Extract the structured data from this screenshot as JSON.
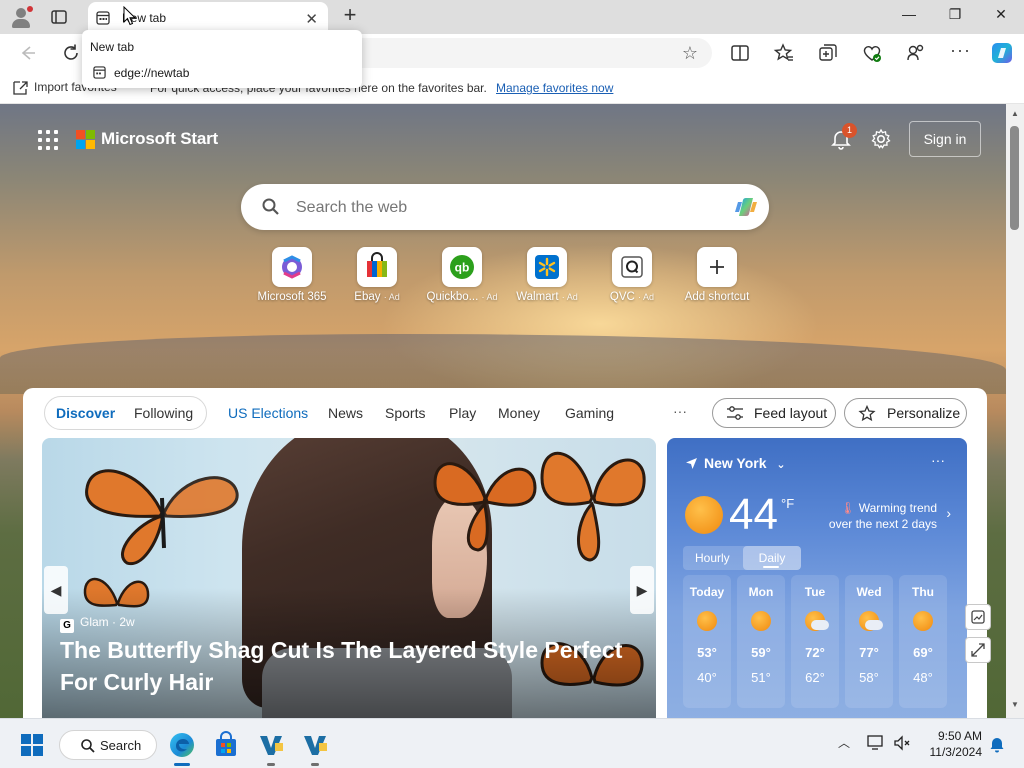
{
  "browser": {
    "tab_title": "New tab",
    "tooltip_title": "New tab",
    "tooltip_url": "edge://newtab",
    "favorites_import": "Import favorites",
    "favorites_hint": "For quick access, place your favorites here on the favorites bar.",
    "favorites_manage": "Manage favorites now",
    "window_controls": {
      "minimize": "—",
      "maximize": "❐",
      "close": "✕"
    }
  },
  "start": {
    "brand": "Microsoft Start",
    "notification_count": "1",
    "sign_in": "Sign in",
    "search_placeholder": "Search the web",
    "shortcuts": [
      {
        "name": "Microsoft 365",
        "ad": ""
      },
      {
        "name": "Ebay",
        "ad": "· Ad"
      },
      {
        "name": "Quickbo...",
        "ad": "· Ad"
      },
      {
        "name": "Walmart",
        "ad": "· Ad"
      },
      {
        "name": "QVC",
        "ad": "· Ad"
      },
      {
        "name": "Add shortcut",
        "ad": ""
      }
    ]
  },
  "feed": {
    "tabs": {
      "discover": "Discover",
      "following": "Following"
    },
    "nav": [
      "US Elections",
      "News",
      "Sports",
      "Play",
      "Money",
      "Gaming"
    ],
    "more": "···",
    "feed_layout": "Feed layout",
    "personalize": "Personalize",
    "hero": {
      "source": "Glam",
      "source_icon": "G",
      "age": "· 2w",
      "headline": "The Butterfly Shag Cut Is The Layered Style Perfect For Curly Hair"
    }
  },
  "weather": {
    "location": "New York",
    "temp": "44",
    "unit": "°F",
    "trend_line1": "Warming trend",
    "trend_line2": "over the next 2 days",
    "tab_hourly": "Hourly",
    "tab_daily": "Daily",
    "more": "···",
    "days": [
      {
        "name": "Today",
        "hi": "53°",
        "lo": "40°",
        "icon": "sunny"
      },
      {
        "name": "Mon",
        "hi": "59°",
        "lo": "51°",
        "icon": "sunny"
      },
      {
        "name": "Tue",
        "hi": "72°",
        "lo": "62°",
        "icon": "partly-cloudy"
      },
      {
        "name": "Wed",
        "hi": "77°",
        "lo": "58°",
        "icon": "partly-cloudy"
      },
      {
        "name": "Thu",
        "hi": "69°",
        "lo": "48°",
        "icon": "sunny"
      }
    ]
  },
  "taskbar": {
    "search_label": "Search",
    "time": "9:50 AM",
    "date": "11/3/2024"
  },
  "colors": {
    "accent": "#0f6cbd",
    "weather_bg": "#4a78c9",
    "badge": "#d9532b"
  }
}
